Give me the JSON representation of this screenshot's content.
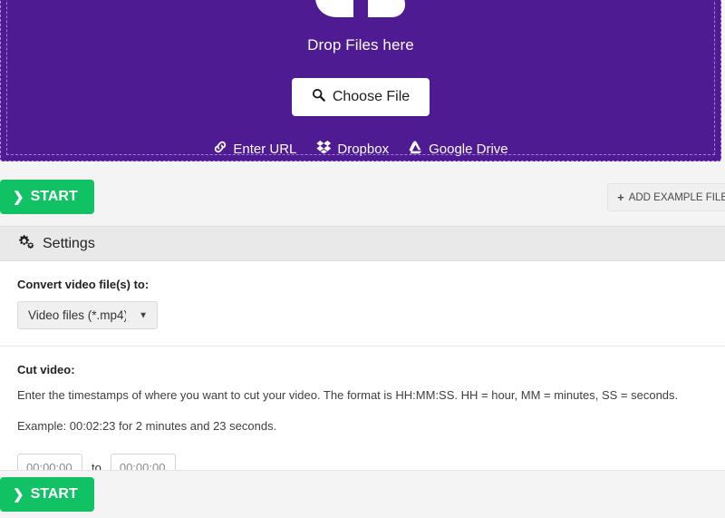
{
  "dropzone": {
    "icon": "cloud-upload-icon",
    "drop_text": "Drop Files here",
    "choose_file_label": "Choose File",
    "choose_file_icon": "magnifier-icon",
    "cloud_links": [
      {
        "label": "Enter URL",
        "icon": "link-icon"
      },
      {
        "label": "Dropbox",
        "icon": "dropbox-icon"
      },
      {
        "label": "Google Drive",
        "icon": "google-drive-icon"
      }
    ],
    "background_color": "#4e1b93"
  },
  "toolbar": {
    "start_label": "START",
    "start_icon": "chevron-right-icon",
    "start_color": "#11c264",
    "add_example_label": "ADD EXAMPLE FILE",
    "add_example_icon": "plus-icon"
  },
  "settings": {
    "header_title": "Settings",
    "header_icon": "cogs-icon",
    "convert": {
      "label": "Convert video file(s) to:",
      "selected": "Video files (*.mp4)",
      "options": [
        "Video files (*.mp4)"
      ]
    },
    "cut": {
      "label": "Cut video:",
      "help_line_1": "Enter the timestamps of where you want to cut your video. The format is HH:MM:SS. HH = hour, MM = minutes, SS = seconds.",
      "help_line_2": "Example: 00:02:23 for 2 minutes and 23 seconds.",
      "from_placeholder": "00:00:00",
      "from_value": "",
      "to_separator": "to",
      "to_placeholder": "00:00:00",
      "to_value": ""
    }
  },
  "footer": {
    "start_label": "START",
    "start_icon": "chevron-right-icon"
  }
}
